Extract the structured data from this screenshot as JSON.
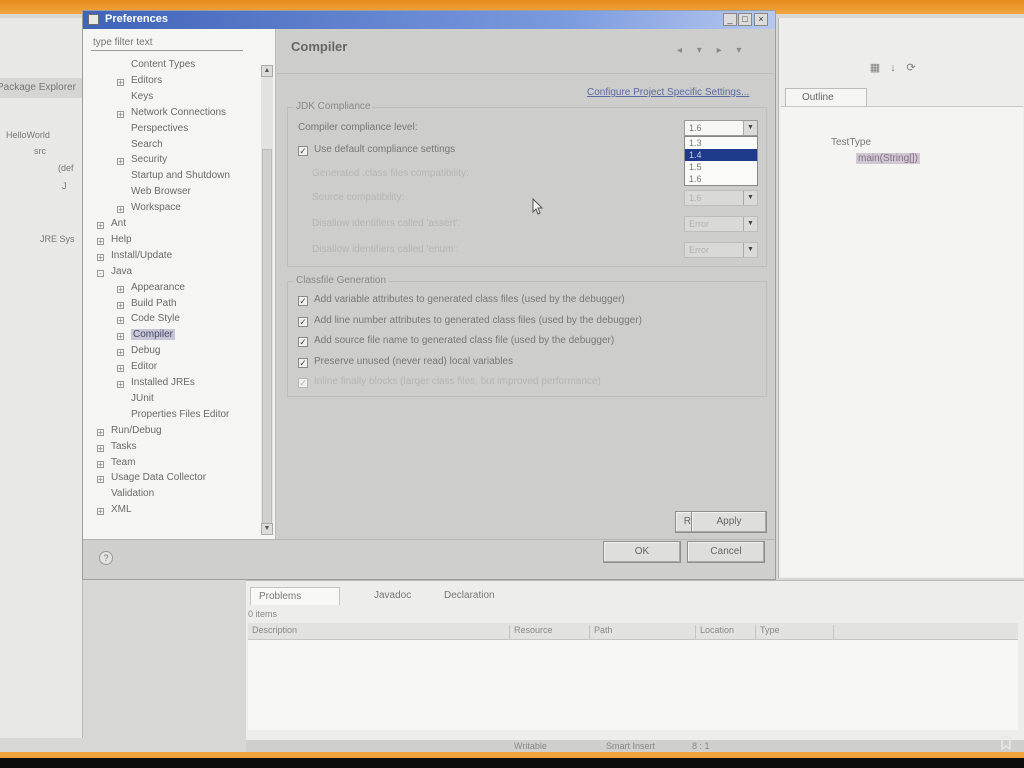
{
  "dialog": {
    "title": "Preferences",
    "filter_placeholder": "type filter text",
    "page_title": "Compiler",
    "configure_link": "Configure Project Specific Settings...",
    "help_label": "?",
    "tree": [
      {
        "label": "Content Types",
        "level": 2,
        "expander": ""
      },
      {
        "label": "Editors",
        "level": 2,
        "expander": "+"
      },
      {
        "label": "Keys",
        "level": 2,
        "expander": ""
      },
      {
        "label": "Network Connections",
        "level": 2,
        "expander": "+"
      },
      {
        "label": "Perspectives",
        "level": 2,
        "expander": ""
      },
      {
        "label": "Search",
        "level": 2,
        "expander": ""
      },
      {
        "label": "Security",
        "level": 2,
        "expander": "+"
      },
      {
        "label": "Startup and Shutdown",
        "level": 2,
        "expander": ""
      },
      {
        "label": "Web Browser",
        "level": 2,
        "expander": ""
      },
      {
        "label": "Workspace",
        "level": 2,
        "expander": "+"
      },
      {
        "label": "Ant",
        "level": 1,
        "expander": "+"
      },
      {
        "label": "Help",
        "level": 1,
        "expander": "+"
      },
      {
        "label": "Install/Update",
        "level": 1,
        "expander": "+"
      },
      {
        "label": "Java",
        "level": 1,
        "expander": "-"
      },
      {
        "label": "Appearance",
        "level": 2,
        "expander": "+"
      },
      {
        "label": "Build Path",
        "level": 2,
        "expander": "+"
      },
      {
        "label": "Code Style",
        "level": 2,
        "expander": "+"
      },
      {
        "label": "Compiler",
        "level": 2,
        "expander": "+",
        "selected": true
      },
      {
        "label": "Debug",
        "level": 2,
        "expander": "+"
      },
      {
        "label": "Editor",
        "level": 2,
        "expander": "+"
      },
      {
        "label": "Installed JREs",
        "level": 2,
        "expander": "+"
      },
      {
        "label": "JUnit",
        "level": 2,
        "expander": ""
      },
      {
        "label": "Properties Files Editor",
        "level": 2,
        "expander": ""
      },
      {
        "label": "Run/Debug",
        "level": 1,
        "expander": "+"
      },
      {
        "label": "Tasks",
        "level": 1,
        "expander": "+"
      },
      {
        "label": "Team",
        "level": 1,
        "expander": "+"
      },
      {
        "label": "Usage Data Collector",
        "level": 1,
        "expander": "+"
      },
      {
        "label": "Validation",
        "level": 1,
        "expander": ""
      },
      {
        "label": "XML",
        "level": 1,
        "expander": "+"
      }
    ],
    "jdk": {
      "group_label": "JDK Compliance",
      "compliance_label": "Compiler compliance level:",
      "compliance_value": "1.6",
      "compliance_options": [
        "1.3",
        "1.4",
        "1.5",
        "1.6"
      ],
      "compliance_highlighted": "1.4",
      "use_default_label": "Use default compliance settings",
      "generated_label": "Generated .class files compatibility:",
      "generated_value": "1.6",
      "source_label": "Source compatibility:",
      "source_value": "1.6",
      "assert_label": "Disallow identifiers called 'assert':",
      "assert_value": "Error",
      "enum_label": "Disallow identifiers called 'enum':",
      "enum_value": "Error"
    },
    "classfile": {
      "group_label": "Classfile Generation",
      "options": [
        {
          "label": "Add variable attributes to generated class files (used by the debugger)",
          "checked": true,
          "enabled": true
        },
        {
          "label": "Add line number attributes to generated class files (used by the debugger)",
          "checked": true,
          "enabled": true
        },
        {
          "label": "Add source file name to generated class file (used by the debugger)",
          "checked": true,
          "enabled": true
        },
        {
          "label": "Preserve unused (never read) local variables",
          "checked": true,
          "enabled": true
        },
        {
          "label": "Inline finally blocks (larger class files, but improved performance)",
          "checked": true,
          "enabled": false
        }
      ]
    },
    "buttons": {
      "restore_defaults": "Restore Defaults",
      "apply": "Apply",
      "ok": "OK",
      "cancel": "Cancel"
    }
  },
  "ide": {
    "package_explorer": {
      "title": "Package Explorer",
      "nodes": [
        "HelloWorld",
        "src",
        "(def",
        "J",
        "JRE Sys"
      ]
    },
    "outline": {
      "tab_label": "Outline",
      "class_node": "TestType",
      "method_node": "main(String[])"
    },
    "problems": {
      "tabs": [
        "Problems",
        "Javadoc",
        "Declaration"
      ],
      "items_count": "0 items",
      "columns": [
        "Description",
        "Resource",
        "Path",
        "Location",
        "Type"
      ]
    },
    "status": {
      "writable": "Writable",
      "insert_mode": "Smart Insert",
      "position": "8 : 1"
    }
  }
}
